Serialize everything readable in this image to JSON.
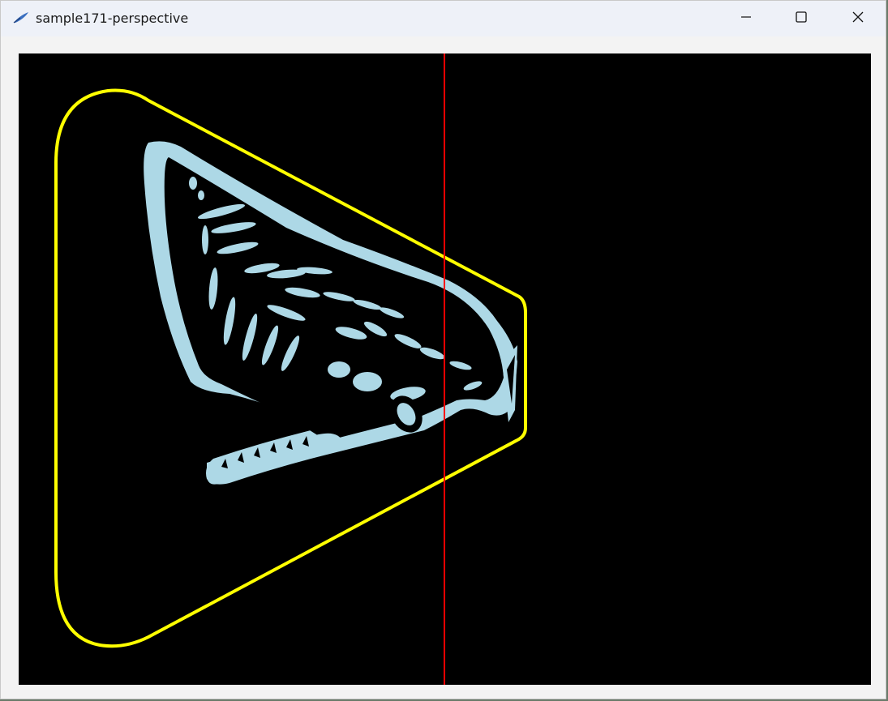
{
  "window": {
    "title": "sample171-perspective",
    "app_icon": "feather-pen-icon"
  },
  "controls": {
    "minimize_icon": "minimize-icon",
    "maximize_icon": "maximize-icon",
    "close_icon": "close-icon"
  },
  "canvas": {
    "background": "#000000",
    "outline_color": "#ffff00",
    "image_color": "#add8e6",
    "divider_color": "#ff0000",
    "image_subject": "whale-head-illustration"
  }
}
